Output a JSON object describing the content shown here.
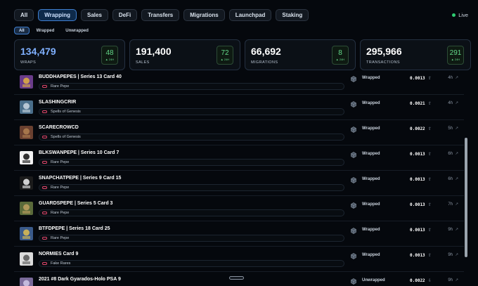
{
  "tabs": [
    {
      "label": "All",
      "active": false
    },
    {
      "label": "Wrapping",
      "active": true
    },
    {
      "label": "Sales",
      "active": false
    },
    {
      "label": "DeFi",
      "active": false
    },
    {
      "label": "Transfers",
      "active": false
    },
    {
      "label": "Migrations",
      "active": false
    },
    {
      "label": "Launchpad",
      "active": false
    },
    {
      "label": "Staking",
      "active": false
    }
  ],
  "live_label": "Live",
  "subtabs": [
    {
      "label": "All",
      "active": true
    },
    {
      "label": "Wrapped",
      "active": false
    },
    {
      "label": "Unwrapped",
      "active": false
    }
  ],
  "stats": [
    {
      "value": "134,479",
      "label": "WRAPS",
      "badge": "48",
      "badge_sub": "▲ 24H",
      "highlight": true
    },
    {
      "value": "191,400",
      "label": "SALES",
      "badge": "72",
      "badge_sub": "▲ 24H",
      "highlight": false
    },
    {
      "value": "66,692",
      "label": "MIGRATIONS",
      "badge": "8",
      "badge_sub": "▲ 24H",
      "highlight": false
    },
    {
      "value": "295,966",
      "label": "TRANSACTIONS",
      "badge": "291",
      "badge_sub": "▲ 24H",
      "highlight": false
    }
  ],
  "rows": [
    {
      "name": "BUDDHAPEPES | Series 13 Card 40",
      "collection": "Rare Pepe",
      "type": "Wrapped",
      "price": "0.0013",
      "arrow": "⇧",
      "age": "4h",
      "ext": "↗",
      "thumb_color": "#6a3c8a",
      "thumb_accent": "#e0b040"
    },
    {
      "name": "SLASHINGCRIR",
      "collection": "Spells of Genesis",
      "type": "Wrapped",
      "price": "0.0021",
      "arrow": "⇧",
      "age": "4h",
      "ext": "↗",
      "thumb_color": "#4a6e8a",
      "thumb_accent": "#c9d6e0"
    },
    {
      "name": "SCARECROWCD",
      "collection": "Spells of Genesis",
      "type": "Wrapped",
      "price": "0.0022",
      "arrow": "⇧",
      "age": "5h",
      "ext": "↗",
      "thumb_color": "#6a4030",
      "thumb_accent": "#b08050"
    },
    {
      "name": "BLKSWANPEPE | Series 10 Card 7",
      "collection": "Rare Pepe",
      "type": "Wrapped",
      "price": "0.0013",
      "arrow": "⇧",
      "age": "6h",
      "ext": "↗",
      "thumb_color": "#f2f2f2",
      "thumb_accent": "#111111"
    },
    {
      "name": "SNAPCHATPEPE | Series 9 Card 15",
      "collection": "Rare Pepe",
      "type": "Wrapped",
      "price": "0.0013",
      "arrow": "⇧",
      "age": "6h",
      "ext": "↗",
      "thumb_color": "#1b1b1b",
      "thumb_accent": "#f0f0f0"
    },
    {
      "name": "GUARDSPEPE | Series 5 Card 3",
      "collection": "Rare Pepe",
      "type": "Wrapped",
      "price": "0.0013",
      "arrow": "⇧",
      "age": "7h",
      "ext": "↗",
      "thumb_color": "#5a6a3a",
      "thumb_accent": "#c0a060"
    },
    {
      "name": "BTFDPEPE | Series 18 Card 25",
      "collection": "Rare Pepe",
      "type": "Wrapped",
      "price": "0.0013",
      "arrow": "⇧",
      "age": "9h",
      "ext": "↗",
      "thumb_color": "#3a5a8a",
      "thumb_accent": "#e0c050"
    },
    {
      "name": "NORMIES Card 9",
      "collection": "Fake Rares",
      "type": "Wrapped",
      "price": "0.0013",
      "arrow": "⇧",
      "age": "9h",
      "ext": "↗",
      "thumb_color": "#dcdcdc",
      "thumb_accent": "#555555"
    },
    {
      "name": "2021 #8 Dark Gyarados-Holo PSA 9",
      "collection": "",
      "type": "Unwrapped",
      "price": "0.0022",
      "arrow": "⇩",
      "age": "9h",
      "ext": "↗",
      "thumb_color": "#7a6a9a",
      "thumb_accent": "#d0c8e8"
    }
  ],
  "colors": {
    "accent": "#3f7fd0",
    "positive": "#64d88a",
    "live": "#2ecc71",
    "link": "#e0466b"
  }
}
